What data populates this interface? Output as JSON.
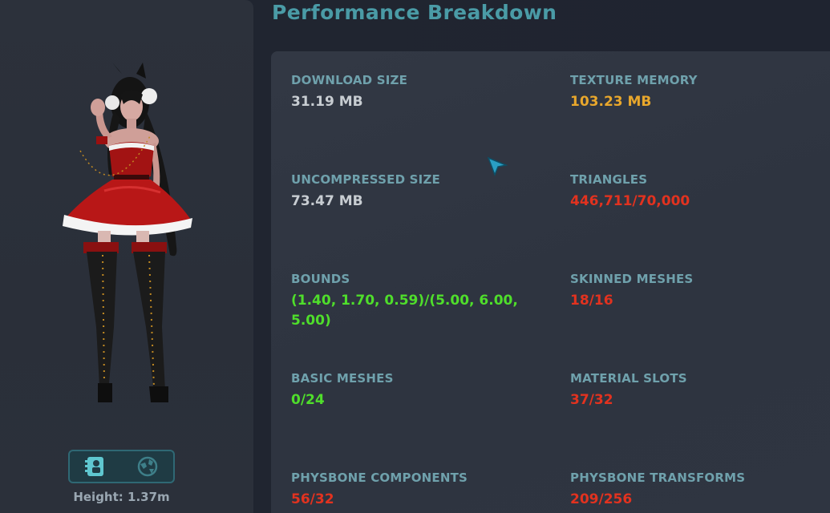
{
  "header": {
    "title": "Performance Breakdown"
  },
  "avatar_panel": {
    "height_label": "Height: 1.37m",
    "mode_buttons": [
      {
        "icon": "avatar-info-icon",
        "active": true
      },
      {
        "icon": "globe-world-icon",
        "active": false
      }
    ]
  },
  "stats": {
    "download_size": {
      "label": "DOWNLOAD SIZE",
      "value": "31.19 MB",
      "status_color": "#c8cdd2"
    },
    "texture_memory": {
      "label": "TEXTURE MEMORY",
      "value": "103.23 MB",
      "status_color": "#e8a72c"
    },
    "uncompressed_size": {
      "label": "UNCOMPRESSED SIZE",
      "value": "73.47 MB",
      "status_color": "#c8cdd2"
    },
    "triangles": {
      "label": "TRIANGLES",
      "value": "446,711/70,000",
      "status_color": "#e2321f"
    },
    "bounds": {
      "label": "BOUNDS",
      "value_line1": "(1.40, 1.70, 0.59)/(5.00, 6.00,",
      "value_line2": "5.00)",
      "status_color": "#4fde2b"
    },
    "skinned_meshes": {
      "label": "SKINNED MESHES",
      "value": "18/16",
      "status_color": "#e2321f"
    },
    "basic_meshes": {
      "label": "BASIC MESHES",
      "value": "0/24",
      "status_color": "#4fde2b"
    },
    "material_slots": {
      "label": "MATERIAL SLOTS",
      "value": "37/32",
      "status_color": "#e2321f"
    },
    "physbone_components": {
      "label": "PHYSBONE COMPONENTS",
      "value": "56/32",
      "status_color": "#e2321f"
    },
    "physbone_transforms": {
      "label": "PHYSBONE TRANSFORMS",
      "value": "209/256",
      "status_color": "#e2321f"
    }
  }
}
